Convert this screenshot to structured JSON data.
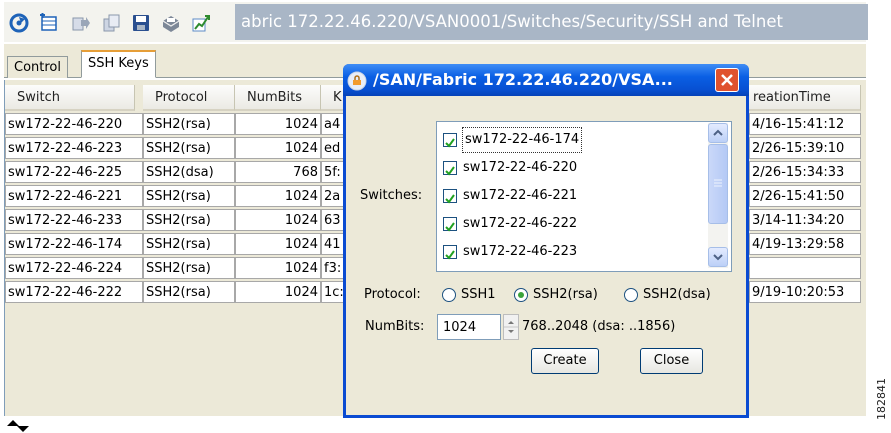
{
  "toolbar": {
    "icons": [
      "refresh-icon",
      "add-row-icon",
      "export-icon",
      "copy-icon",
      "save-icon",
      "print-icon",
      "graph-icon"
    ],
    "path": "abric 172.22.46.220/VSAN0001/Switches/Security/SSH and Telnet"
  },
  "tabs": [
    {
      "label": "Control",
      "active": false
    },
    {
      "label": "SSH Keys",
      "active": true
    }
  ],
  "table": {
    "headers": [
      "Switch",
      "Protocol",
      "NumBits",
      "K",
      "reationTime"
    ],
    "rows": [
      {
        "switch": "sw172-22-46-220",
        "protocol": "SSH2(rsa)",
        "numbits": "1024",
        "key": "a4",
        "time": "4/16-15:41:12"
      },
      {
        "switch": "sw172-22-46-223",
        "protocol": "SSH2(rsa)",
        "numbits": "1024",
        "key": "ed",
        "time": "2/26-15:39:10"
      },
      {
        "switch": "sw172-22-46-225",
        "protocol": "SSH2(dsa)",
        "numbits": "768",
        "key": "5f:",
        "time": "2/26-15:34:33"
      },
      {
        "switch": "sw172-22-46-221",
        "protocol": "SSH2(rsa)",
        "numbits": "1024",
        "key": "2a",
        "time": "2/26-15:41:50"
      },
      {
        "switch": "sw172-22-46-233",
        "protocol": "SSH2(rsa)",
        "numbits": "1024",
        "key": "63",
        "time": "3/14-11:34:20"
      },
      {
        "switch": "sw172-22-46-174",
        "protocol": "SSH2(rsa)",
        "numbits": "1024",
        "key": "41",
        "time": "4/19-13:29:58"
      },
      {
        "switch": "sw172-22-46-224",
        "protocol": "SSH2(rsa)",
        "numbits": "1024",
        "key": "f3:",
        "time": ""
      },
      {
        "switch": "sw172-22-46-222",
        "protocol": "SSH2(rsa)",
        "numbits": "1024",
        "key": "1c:",
        "time": "9/19-10:20:53"
      }
    ]
  },
  "dialog": {
    "title": "/SAN/Fabric 172.22.46.220/VSA...",
    "switches_label": "Switches:",
    "switches": [
      {
        "name": "sw172-22-46-174",
        "checked": true
      },
      {
        "name": "sw172-22-46-220",
        "checked": true
      },
      {
        "name": "sw172-22-46-221",
        "checked": true
      },
      {
        "name": "sw172-22-46-222",
        "checked": true
      },
      {
        "name": "sw172-22-46-223",
        "checked": true
      }
    ],
    "protocol_label": "Protocol:",
    "protocol_options": [
      "SSH1",
      "SSH2(rsa)",
      "SSH2(dsa)"
    ],
    "protocol_selected": "SSH2(rsa)",
    "numbits_label": "NumBits:",
    "numbits_value": "1024",
    "numbits_range": "768..2048 (dsa: ..1856)",
    "create_label": "Create",
    "close_label": "Close"
  },
  "watermark": "182841",
  "colors": {
    "title_bar": "#0a5fe4",
    "path_bar": "#a9b6c6",
    "close_button": "#e0522e",
    "check_mark": "#21a121",
    "active_tab_accent": "#e69e37"
  }
}
